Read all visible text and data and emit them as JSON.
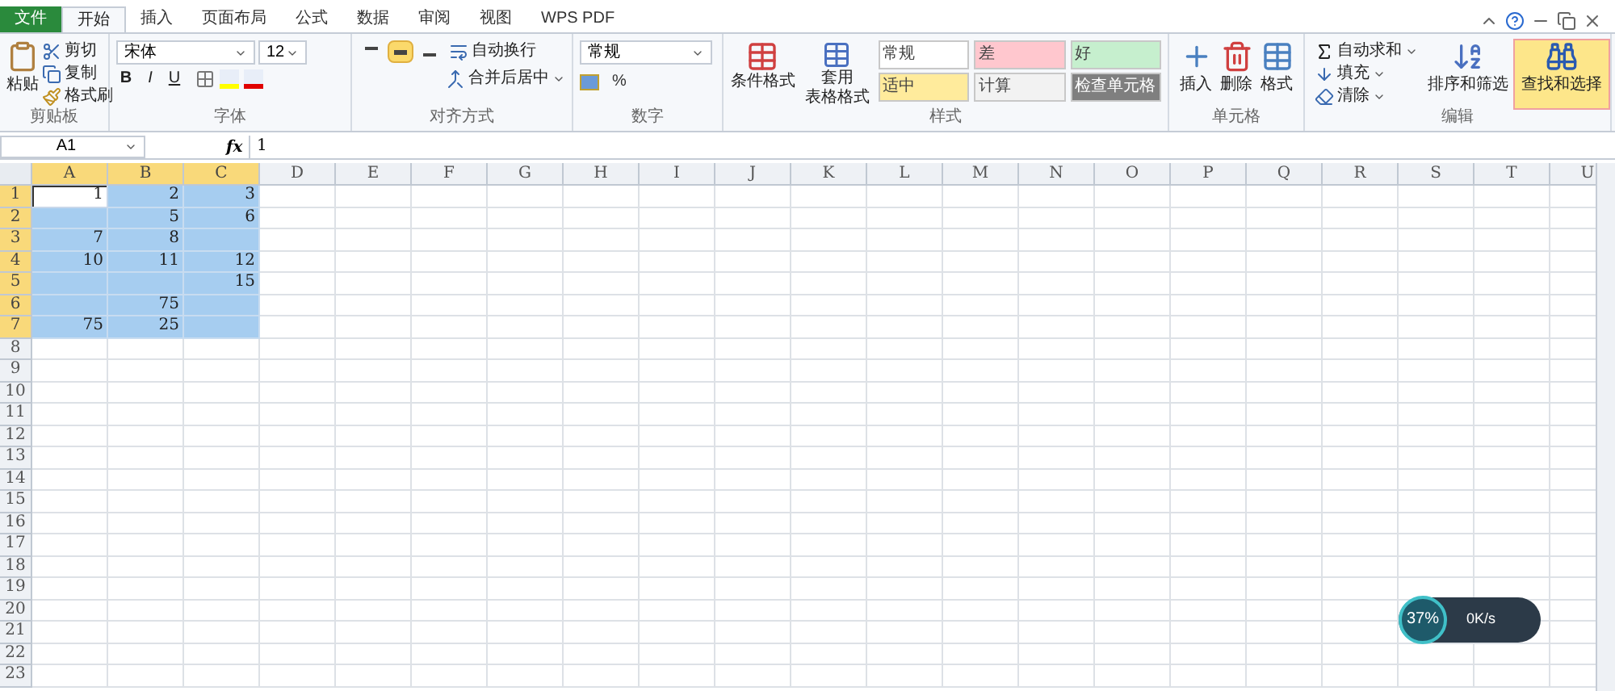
{
  "tabs": [
    {
      "label": "文件",
      "kind": "file",
      "selected": false
    },
    {
      "label": "开始",
      "kind": "tab",
      "selected": true
    },
    {
      "label": "插入",
      "kind": "tab",
      "selected": false
    },
    {
      "label": "页面布局",
      "kind": "tab",
      "selected": false
    },
    {
      "label": "公式",
      "kind": "tab",
      "selected": false
    },
    {
      "label": "数据",
      "kind": "tab",
      "selected": false
    },
    {
      "label": "审阅",
      "kind": "tab",
      "selected": false
    },
    {
      "label": "视图",
      "kind": "tab",
      "selected": false
    },
    {
      "label": "WPS PDF",
      "kind": "tab",
      "selected": false
    }
  ],
  "clipboard": {
    "group": "剪贴板",
    "paste": "粘贴",
    "items": [
      "剪切",
      "复制",
      "格式刷"
    ]
  },
  "font": {
    "group": "字体",
    "name": "宋体",
    "size": "12",
    "styles": [
      "B",
      "I",
      "U"
    ]
  },
  "alignment": {
    "group": "对齐方式",
    "wrap": "自动换行",
    "merge": "合并后居中",
    "buttons": [
      {
        "kind": "top",
        "selected": false
      },
      {
        "kind": "middle",
        "selected": true
      },
      {
        "kind": "bottom",
        "selected": false
      }
    ]
  },
  "number": {
    "group": "数字",
    "format": "常规",
    "percent": "%"
  },
  "styles": {
    "group": "样式",
    "conditional": "条件格式",
    "table_format": [
      "套用",
      "表格格式"
    ],
    "cell_styles": [
      {
        "label": "常规",
        "color": "#ffffff"
      },
      {
        "label": "差",
        "color": "#ffc7ce"
      },
      {
        "label": "好",
        "color": "#c6efce"
      },
      {
        "label": "适中",
        "color": "#ffeb9c"
      },
      {
        "label": "计算",
        "color": "#f2f2f2"
      },
      {
        "label": "检查单元格",
        "color": "#7f7f7f"
      }
    ]
  },
  "cells": {
    "group": "单元格",
    "items": [
      "插入",
      "删除",
      "格式"
    ]
  },
  "editing": {
    "group": "编辑",
    "items": [
      "自动求和",
      "填充",
      "清除"
    ],
    "sort": "排序和筛选",
    "find": {
      "label": "查找和选择",
      "selected": true
    }
  },
  "formula_bar": {
    "name_box": "A1",
    "function_label": "fx",
    "value": "1"
  },
  "sheet": {
    "columns": [
      {
        "label": "A",
        "selected": true
      },
      {
        "label": "B",
        "selected": true
      },
      {
        "label": "C",
        "selected": true
      },
      {
        "label": "D",
        "selected": false
      },
      {
        "label": "E",
        "selected": false
      },
      {
        "label": "F",
        "selected": false
      },
      {
        "label": "G",
        "selected": false
      },
      {
        "label": "H",
        "selected": false
      },
      {
        "label": "I",
        "selected": false
      },
      {
        "label": "J",
        "selected": false
      },
      {
        "label": "K",
        "selected": false
      },
      {
        "label": "L",
        "selected": false
      },
      {
        "label": "M",
        "selected": false
      },
      {
        "label": "N",
        "selected": false
      },
      {
        "label": "O",
        "selected": false
      },
      {
        "label": "P",
        "selected": false
      },
      {
        "label": "Q",
        "selected": false
      },
      {
        "label": "R",
        "selected": false
      },
      {
        "label": "S",
        "selected": false
      },
      {
        "label": "T",
        "selected": false
      },
      {
        "label": "U",
        "selected": false
      }
    ],
    "rows": [
      {
        "label": "1",
        "selected": true,
        "cells": [
          {
            "value": "1",
            "selected": true,
            "active": true
          },
          {
            "value": "2",
            "selected": true,
            "active": false
          },
          {
            "value": "3",
            "selected": true,
            "active": false
          }
        ]
      },
      {
        "label": "2",
        "selected": true,
        "cells": [
          {
            "selected": true,
            "active": false
          },
          {
            "value": "5",
            "selected": true,
            "active": false
          },
          {
            "value": "6",
            "selected": true,
            "active": false
          }
        ]
      },
      {
        "label": "3",
        "selected": true,
        "cells": [
          {
            "value": "7",
            "selected": true,
            "active": false
          },
          {
            "value": "8",
            "selected": true,
            "active": false
          },
          {
            "selected": true,
            "active": false
          }
        ]
      },
      {
        "label": "4",
        "selected": true,
        "cells": [
          {
            "value": "10",
            "selected": true,
            "active": false
          },
          {
            "value": "11",
            "selected": true,
            "active": false
          },
          {
            "value": "12",
            "selected": true,
            "active": false
          }
        ]
      },
      {
        "label": "5",
        "selected": true,
        "cells": [
          {
            "selected": true,
            "active": false
          },
          {
            "selected": true,
            "active": false
          },
          {
            "value": "15",
            "selected": true,
            "active": false
          }
        ]
      },
      {
        "label": "6",
        "selected": true,
        "cells": [
          {
            "selected": true,
            "active": false
          },
          {
            "value": "75",
            "selected": true,
            "active": false
          },
          {
            "selected": true,
            "active": false
          }
        ]
      },
      {
        "label": "7",
        "selected": true,
        "cells": [
          {
            "value": "75",
            "selected": true,
            "active": false
          },
          {
            "value": "25",
            "selected": true,
            "active": false
          },
          {
            "selected": true,
            "active": false
          }
        ]
      },
      {
        "label": "8",
        "selected": false
      },
      {
        "label": "9",
        "selected": false
      },
      {
        "label": "10",
        "selected": false
      },
      {
        "label": "11",
        "selected": false
      },
      {
        "label": "12",
        "selected": false
      },
      {
        "label": "13",
        "selected": false
      },
      {
        "label": "14",
        "selected": false
      },
      {
        "label": "15",
        "selected": false
      },
      {
        "label": "16",
        "selected": false
      },
      {
        "label": "17",
        "selected": false
      },
      {
        "label": "18",
        "selected": false
      },
      {
        "label": "19",
        "selected": false
      },
      {
        "label": "20",
        "selected": false
      },
      {
        "label": "21",
        "selected": false
      },
      {
        "label": "22",
        "selected": false
      },
      {
        "label": "23",
        "selected": false
      }
    ]
  },
  "net_widget": {
    "percent": "37%",
    "speed": "0K/s"
  }
}
